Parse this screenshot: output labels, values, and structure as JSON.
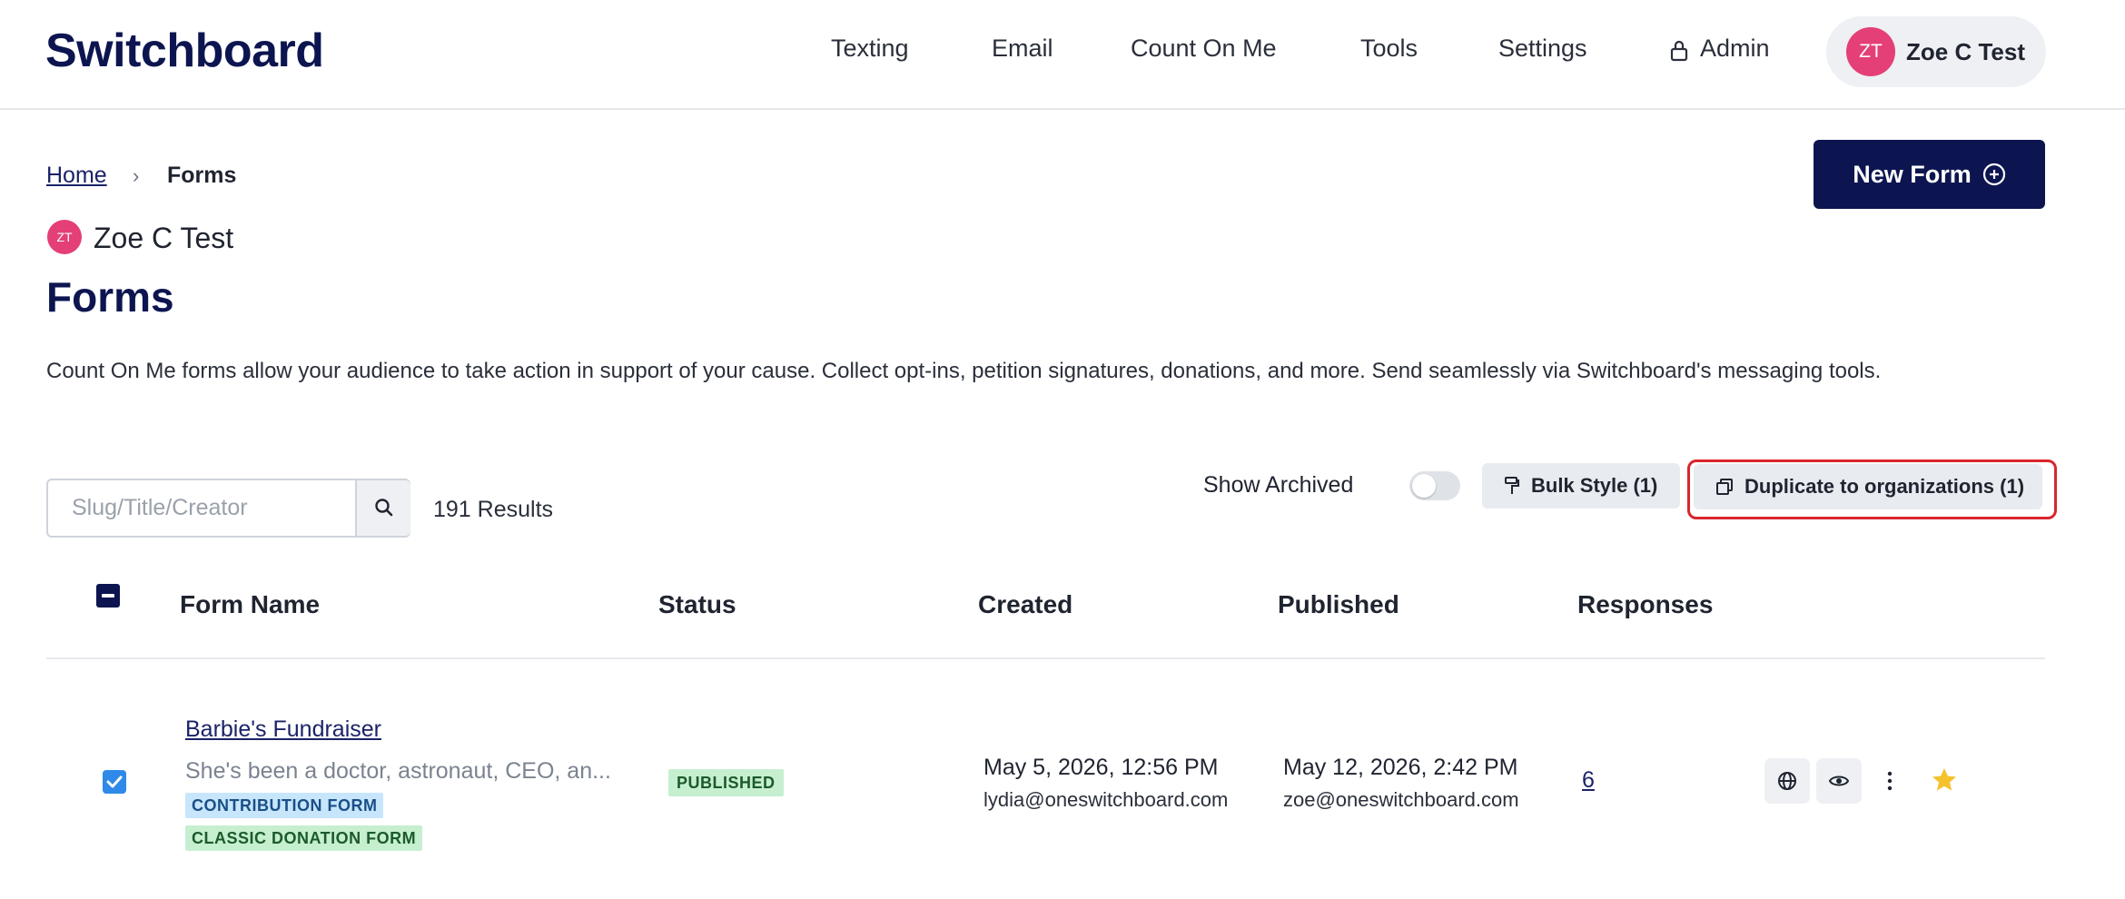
{
  "header": {
    "logo": "Switchboard",
    "nav": [
      "Texting",
      "Email",
      "Count On Me",
      "Tools",
      "Settings"
    ],
    "admin_label": "Admin",
    "user": {
      "initials": "ZT",
      "name": "Zoe C Test"
    }
  },
  "breadcrumb": {
    "home": "Home",
    "separator": "›",
    "current": "Forms"
  },
  "new_form_label": "New Form",
  "org": {
    "initials": "ZT",
    "name": "Zoe C Test"
  },
  "page_title": "Forms",
  "description": "Count On Me forms allow your audience to take action in support of your cause. Collect opt-ins, petition signatures, donations, and more. Send seamlessly via Switchboard's messaging tools.",
  "toolbar": {
    "search_placeholder": "Slug/Title/Creator",
    "results": "191 Results",
    "show_archived": "Show Archived",
    "bulk_style": "Bulk Style (1)",
    "duplicate": "Duplicate to organizations (1)"
  },
  "table": {
    "columns": [
      "Form Name",
      "Status",
      "Created",
      "Published",
      "Responses"
    ],
    "rows": [
      {
        "name": "Barbie's Fundraiser",
        "subtitle": "She's been a doctor, astronaut, CEO, an...",
        "tags": [
          "CONTRIBUTION FORM",
          "CLASSIC DONATION FORM"
        ],
        "status": "PUBLISHED",
        "created_date": "May 5, 2026, 12:56 PM",
        "created_by": "lydia@oneswitchboard.com",
        "published_date": "May 12, 2026, 2:42 PM",
        "published_by": "zoe@oneswitchboard.com",
        "responses": "6"
      }
    ]
  },
  "colors": {
    "brand_navy": "#0d1550",
    "avatar_pink": "#e43f77",
    "highlight_red": "#d8262d",
    "checkbox_blue": "#2f89e8",
    "star_yellow": "#f5c22c"
  }
}
